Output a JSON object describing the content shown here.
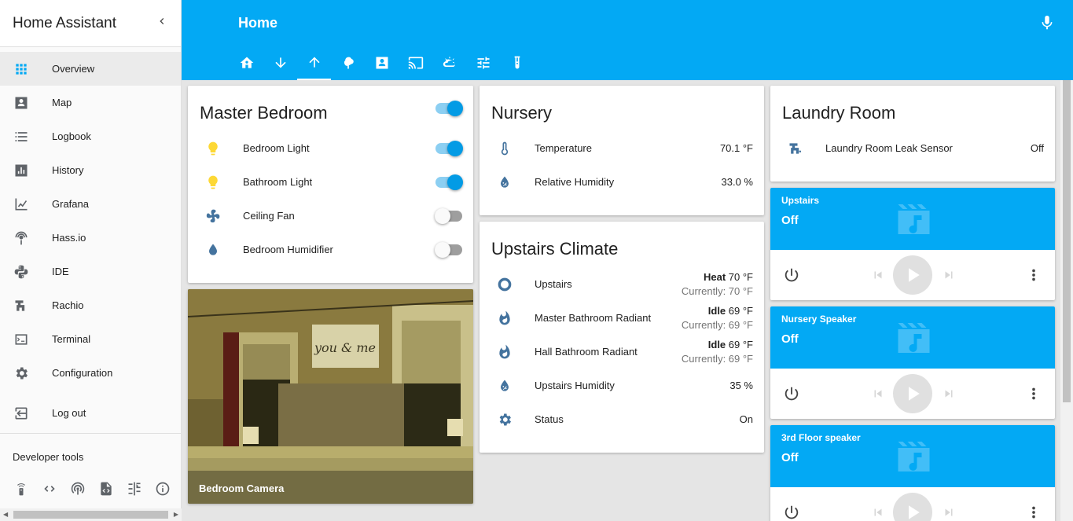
{
  "sidebar": {
    "title": "Home Assistant",
    "items": [
      {
        "label": "Overview",
        "icon": "grid-icon"
      },
      {
        "label": "Map",
        "icon": "map-icon"
      },
      {
        "label": "Logbook",
        "icon": "logbook-icon"
      },
      {
        "label": "History",
        "icon": "history-icon"
      },
      {
        "label": "Grafana",
        "icon": "chart-icon"
      },
      {
        "label": "Hass.io",
        "icon": "hassio-icon"
      },
      {
        "label": "IDE",
        "icon": "python-icon"
      },
      {
        "label": "Rachio",
        "icon": "sprinkler-icon"
      },
      {
        "label": "Terminal",
        "icon": "terminal-icon"
      },
      {
        "label": "Configuration",
        "icon": "gear-icon"
      }
    ],
    "logout": "Log out",
    "developer_tools_title": "Developer tools"
  },
  "header": {
    "title": "Home"
  },
  "master_bedroom": {
    "title": "Master Bedroom",
    "rows": [
      {
        "name": "Bedroom Light",
        "state": "on"
      },
      {
        "name": "Bathroom Light",
        "state": "on"
      },
      {
        "name": "Ceiling Fan",
        "state": "off"
      },
      {
        "name": "Bedroom Humidifier",
        "state": "off"
      }
    ]
  },
  "camera": {
    "caption": "Bedroom Camera"
  },
  "nursery": {
    "title": "Nursery",
    "rows": [
      {
        "name": "Temperature",
        "value": "70.1 °F"
      },
      {
        "name": "Relative Humidity",
        "value": "33.0 %"
      }
    ]
  },
  "climate": {
    "title": "Upstairs Climate",
    "rows": [
      {
        "name": "Upstairs",
        "mode": "Heat",
        "target": " 70 °F",
        "current": "Currently: 70 °F"
      },
      {
        "name": "Master Bathroom Radiant",
        "mode": "Idle",
        "target": " 69 °F",
        "current": "Currently: 69 °F"
      },
      {
        "name": "Hall Bathroom Radiant",
        "mode": "Idle",
        "target": " 69 °F",
        "current": "Currently: 69 °F"
      },
      {
        "name": "Upstairs Humidity",
        "value": "35 %"
      },
      {
        "name": "Status",
        "value": "On"
      }
    ]
  },
  "laundry": {
    "title": "Laundry Room",
    "rows": [
      {
        "name": "Laundry Room Leak Sensor",
        "value": "Off"
      }
    ]
  },
  "media_players": [
    {
      "name": "Upstairs",
      "state": "Off"
    },
    {
      "name": "Nursery Speaker",
      "state": "Off"
    },
    {
      "name": "3rd Floor speaker",
      "state": "Off"
    }
  ],
  "colors": {
    "accent": "#03a9f4",
    "icon": "#44739e",
    "light_on": "#fdd835"
  }
}
